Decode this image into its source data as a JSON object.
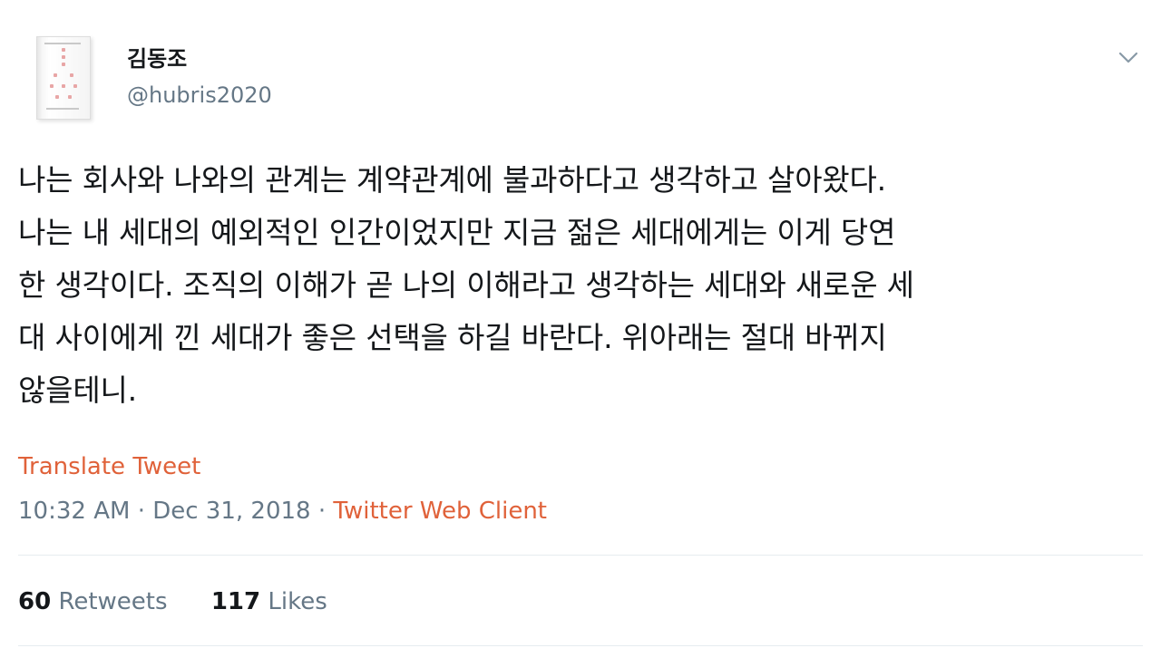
{
  "author": {
    "name": "김동조",
    "handle": "@hubris2020"
  },
  "tweet": {
    "text": "나는 회사와 나와의 관계는 계약관계에 불과하다고 생각하고 살아왔다.\n나는 내 세대의 예외적인 인간이었지만 지금 젊은 세대에게는 이게 당연\n한 생각이다. 조직의 이해가 곧 나의 이해라고 생각하는 세대와 새로운 세\n대 사이에게 낀 세대가 좋은 선택을 하길 바란다. 위아래는 절대 바뀌지\n않을테니.",
    "translate_label": "Translate Tweet",
    "time": "10:32 AM",
    "date": "Dec 31, 2018",
    "separator": "·",
    "client": "Twitter Web Client"
  },
  "stats": {
    "retweets_count": "60",
    "retweets_label": "Retweets",
    "likes_count": "117",
    "likes_label": "Likes"
  },
  "icons": {
    "menu": "chevron-down-icon",
    "avatar": "book-cover-avatar"
  },
  "colors": {
    "text": "#14171a",
    "secondary": "#657786",
    "link": "#e0623a",
    "divider": "#e6ecf0"
  }
}
